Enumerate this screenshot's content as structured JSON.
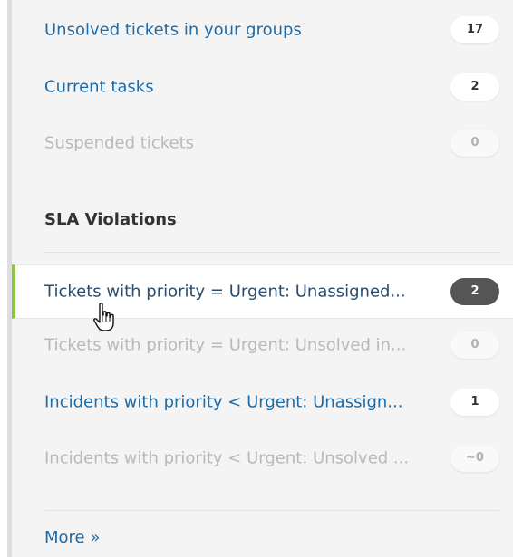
{
  "views": [
    {
      "label": "Unsolved tickets in your groups",
      "count": "17"
    },
    {
      "label": "Current tasks",
      "count": "2"
    },
    {
      "label": "Suspended tickets",
      "count": "0"
    }
  ],
  "sla": {
    "title": "SLA Violations",
    "items": [
      {
        "label": "Tickets with priority = Urgent: Unassigned...",
        "count": "2"
      },
      {
        "label": "Tickets with priority = Urgent: Unsolved in...",
        "count": "0"
      },
      {
        "label": "Incidents with priority < Urgent: Unassign...",
        "count": "1"
      },
      {
        "label": "Incidents with priority < Urgent: Unsolved ...",
        "count": "~0"
      }
    ]
  },
  "more_label": "More »",
  "colors": {
    "link": "#1f6ba6",
    "muted": "#b9b9b9",
    "selected_border": "#8cc63f",
    "selected_badge": "#555555"
  },
  "cursor_icon": "hand-pointer-icon"
}
